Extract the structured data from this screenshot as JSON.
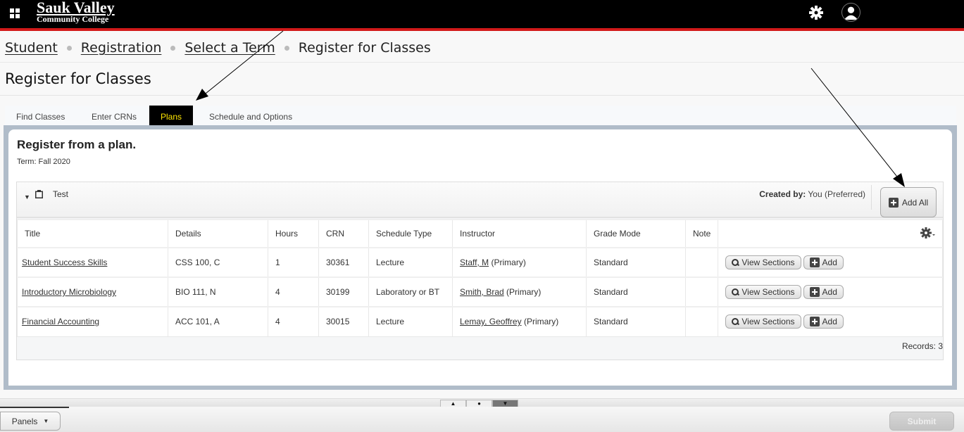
{
  "header": {
    "logo_line1": "Sauk Valley",
    "logo_line2": "Community College",
    "icons": [
      "grid-menu-icon",
      "gear-icon",
      "user-icon"
    ]
  },
  "breadcrumb": {
    "items": [
      "Student",
      "Registration",
      "Select a Term"
    ],
    "current": "Register for Classes"
  },
  "page_title": "Register for Classes",
  "tabs": [
    {
      "label": "Find Classes",
      "active": false
    },
    {
      "label": "Enter CRNs",
      "active": false
    },
    {
      "label": "Plans",
      "active": true
    },
    {
      "label": "Schedule and Options",
      "active": false
    }
  ],
  "panel": {
    "heading": "Register from a plan.",
    "term": "Term: Fall 2020",
    "plan": {
      "name": "Test",
      "created_by_label": "Created by:",
      "created_by_value": "You (Preferred)",
      "add_all_label": "Add All"
    },
    "table": {
      "columns": [
        "Title",
        "Details",
        "Hours",
        "CRN",
        "Schedule Type",
        "Instructor",
        "Grade Mode",
        "Note"
      ],
      "rows": [
        {
          "title": "Student Success Skills",
          "details": "CSS 100, C",
          "hours": "1",
          "crn": "30361",
          "schedule_type": "Lecture",
          "instructor": "Staff, M",
          "instructor_role": "(Primary)",
          "grade_mode": "Standard",
          "note": ""
        },
        {
          "title": "Introductory Microbiology",
          "details": "BIO 111, N",
          "hours": "4",
          "crn": "30199",
          "schedule_type": "Laboratory or BT",
          "instructor": "Smith, Brad",
          "instructor_role": "(Primary)",
          "grade_mode": "Standard",
          "note": ""
        },
        {
          "title": "Financial Accounting",
          "details": "ACC 101, A",
          "hours": "4",
          "crn": "30015",
          "schedule_type": "Lecture",
          "instructor": "Lemay, Geoffrey",
          "instructor_role": "(Primary)",
          "grade_mode": "Standard",
          "note": ""
        }
      ],
      "view_sections_label": "View Sections",
      "add_label": "Add",
      "records": "Records: 3"
    }
  },
  "footer": {
    "panels_label": "Panels",
    "submit_label": "Submit"
  }
}
